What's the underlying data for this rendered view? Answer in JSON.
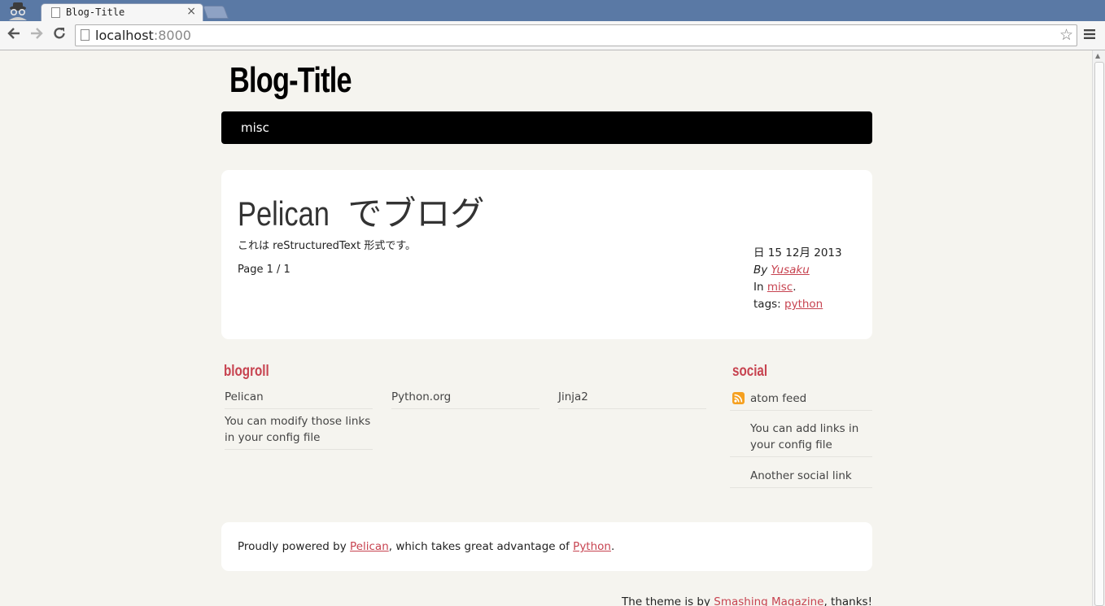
{
  "browser": {
    "tab_title": "Blog-Title",
    "tab_close": "×",
    "url_host": "localhost",
    "url_port": ":8000"
  },
  "site": {
    "title": "Blog-Title",
    "menu": [
      "misc"
    ]
  },
  "article": {
    "title_latin": "Pelican",
    "title_jp": " でブログ",
    "body": "これは reStructuredText 形式です。",
    "pager": "Page 1 / 1",
    "date": "日 15 12月 2013",
    "by_label": "By ",
    "author": "Yusaku",
    "in_label": "In ",
    "category": "misc",
    "category_suffix": ".",
    "tags_label": "tags: ",
    "tag": "python"
  },
  "blogroll": {
    "title": "blogroll",
    "links": [
      "Pelican",
      "Python.org",
      "Jinja2",
      "You can modify those links in your config file"
    ]
  },
  "social": {
    "title": "social",
    "links": [
      "atom feed",
      "You can add links in your config file",
      "Another social link"
    ]
  },
  "footer": {
    "prefix": "Proudly powered by ",
    "pelican": "Pelican",
    "middle": ", which takes great advantage of ",
    "python": "Python",
    "suffix": "."
  },
  "credit": {
    "prefix": "The theme is by ",
    "link": "Smashing Magazine",
    "suffix": ", thanks!"
  },
  "colors": {
    "accent": "#c74350",
    "menubar": "#000000",
    "page_background": "#f5f4ef",
    "tabstrip": "#5a79a5"
  },
  "icons": [
    "incognito-icon",
    "page-icon",
    "back-arrow-icon",
    "forward-arrow-icon",
    "reload-icon",
    "star-icon",
    "menu-icon",
    "rss-icon"
  ]
}
